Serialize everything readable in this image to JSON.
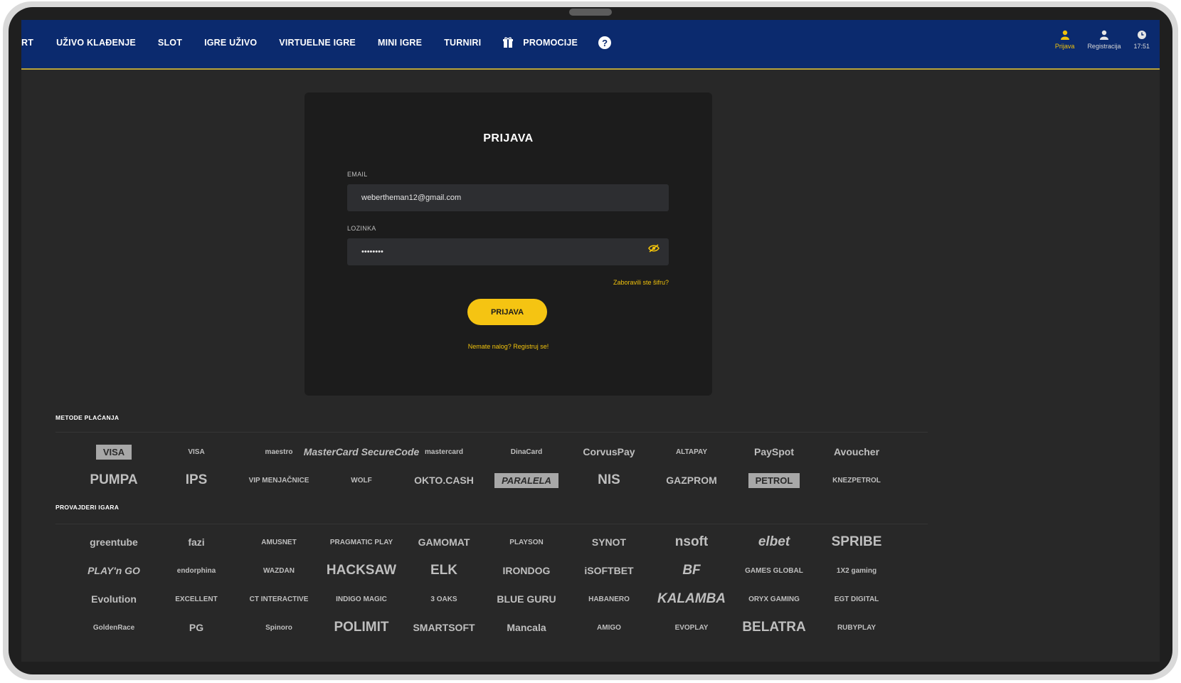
{
  "nav": {
    "items": [
      "RT",
      "UŽIVO KLAĐENJE",
      "SLOT",
      "IGRE UŽIVO",
      "VIRTUELNE IGRE",
      "MINI IGRE",
      "TURNIRI",
      "PROMOCIJE"
    ],
    "help_label": "?"
  },
  "user_menu": {
    "login_label": "Prijava",
    "register_label": "Registracija",
    "time": "17:51"
  },
  "login": {
    "title": "PRIJAVA",
    "email_label": "EMAIL",
    "email_value": "webertheman12@gmail.com",
    "password_label": "LOZINKA",
    "password_value": "••••••••",
    "forgot_link": "Zaboravili ste šifru?",
    "submit_label": "PRIJAVA",
    "register_link": "Nemate nalog? Registruj se!"
  },
  "payments": {
    "title": "METODE PLAĆANJA",
    "logos": [
      "VISA",
      "VISA",
      "maestro",
      "MasterCard SecureCode",
      "mastercard",
      "DinaCard",
      "CorvusPay",
      "ALTAPAY",
      "PaySpot",
      "Avoucher",
      "PUMPA",
      "IPS",
      "VIP MENJAČNICE",
      "WOLF",
      "OKTO.CASH",
      "PARALELA",
      "NIS",
      "GAZPROM",
      "PETROL",
      "KNEZPETROL"
    ]
  },
  "providers": {
    "title": "PROVAJDERI IGARA",
    "logos": [
      "greentube",
      "fazi",
      "AMUSNET",
      "PRAGMATIC PLAY",
      "GAMOMAT",
      "PLAYSON",
      "SYNOT",
      "nsoft",
      "elbet",
      "SPRIBE",
      "PLAY'n GO",
      "endorphina",
      "WAZDAN",
      "HACKSAW",
      "ELK",
      "IRONDOG",
      "iSOFTBET",
      "BF",
      "GAMES GLOBAL",
      "1X2 gaming",
      "Evolution",
      "EXCELLENT",
      "CT INTERACTIVE",
      "INDIGO MAGIC",
      "3 OAKS",
      "BLUE GURU",
      "HABANERO",
      "KALAMBA",
      "ORYX GAMING",
      "EGT DIGITAL",
      "GoldenRace",
      "PG",
      "Spinoro",
      "POLIMIT",
      "SMARTSOFT",
      "Mancala",
      "AMIGO",
      "EVOPLAY",
      "BELATRA",
      "RUBYPLAY"
    ]
  }
}
